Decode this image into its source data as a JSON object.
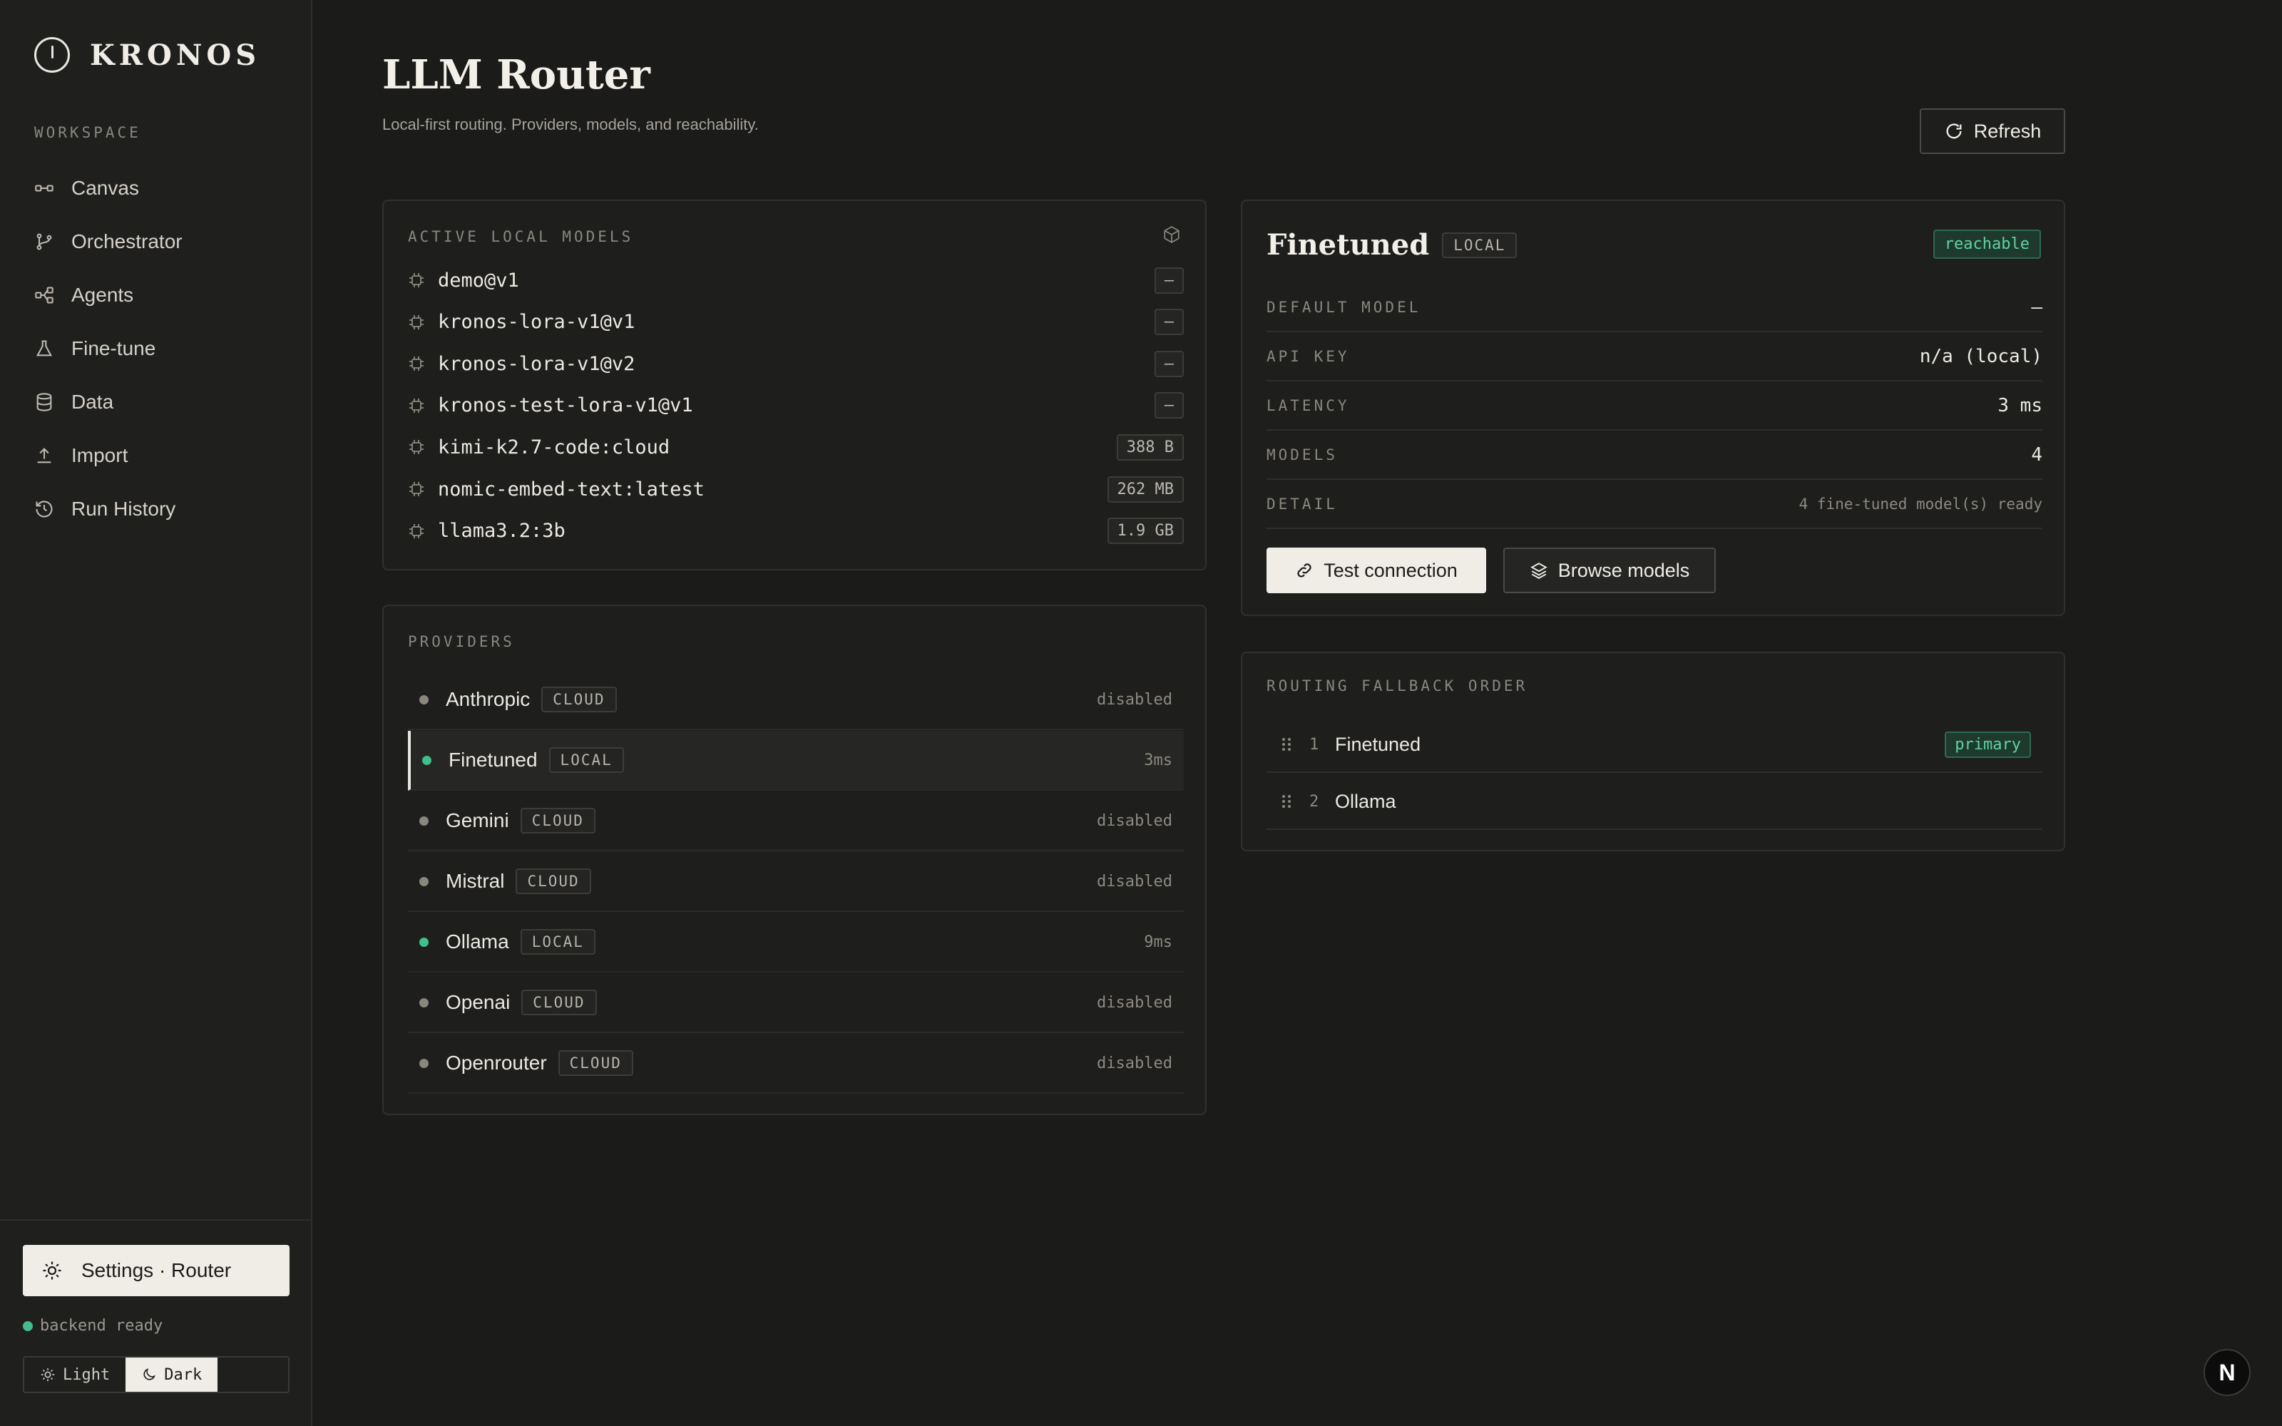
{
  "brand": {
    "name": "KRONOS"
  },
  "sidebar": {
    "section_label": "WORKSPACE",
    "items": [
      {
        "label": "Canvas",
        "icon": "canvas-icon"
      },
      {
        "label": "Orchestrator",
        "icon": "branch-icon"
      },
      {
        "label": "Agents",
        "icon": "share-icon"
      },
      {
        "label": "Fine-tune",
        "icon": "flask-icon"
      },
      {
        "label": "Data",
        "icon": "database-icon"
      },
      {
        "label": "Import",
        "icon": "upload-icon"
      },
      {
        "label": "Run History",
        "icon": "history-icon"
      }
    ],
    "settings_label": "Settings · Router",
    "status": "backend ready",
    "theme": {
      "light": "Light",
      "dark": "Dark",
      "selected": "Dark"
    }
  },
  "header": {
    "title": "LLM Router",
    "subtitle": "Local-first routing. Providers, models, and reachability.",
    "refresh_label": "Refresh"
  },
  "models": {
    "label": "ACTIVE LOCAL MODELS",
    "rows": [
      {
        "name": "demo@v1",
        "size": "—"
      },
      {
        "name": "kronos-lora-v1@v1",
        "size": "—"
      },
      {
        "name": "kronos-lora-v1@v2",
        "size": "—"
      },
      {
        "name": "kronos-test-lora-v1@v1",
        "size": "—"
      },
      {
        "name": "kimi-k2.7-code:cloud",
        "size": "388 B"
      },
      {
        "name": "nomic-embed-text:latest",
        "size": "262 MB"
      },
      {
        "name": "llama3.2:3b",
        "size": "1.9 GB"
      }
    ]
  },
  "providers": {
    "label": "PROVIDERS",
    "rows": [
      {
        "name": "Anthropic",
        "tag": "CLOUD",
        "meta": "disabled",
        "active": false
      },
      {
        "name": "Finetuned",
        "tag": "LOCAL",
        "meta": "3ms",
        "active": true
      },
      {
        "name": "Gemini",
        "tag": "CLOUD",
        "meta": "disabled",
        "active": false
      },
      {
        "name": "Mistral",
        "tag": "CLOUD",
        "meta": "disabled",
        "active": false
      },
      {
        "name": "Ollama",
        "tag": "LOCAL",
        "meta": "9ms",
        "active": true
      },
      {
        "name": "Openai",
        "tag": "CLOUD",
        "meta": "disabled",
        "active": false
      },
      {
        "name": "Openrouter",
        "tag": "CLOUD",
        "meta": "disabled",
        "active": false
      }
    ],
    "selected": "Finetuned"
  },
  "detail": {
    "name": "Finetuned",
    "tag": "LOCAL",
    "status": "reachable",
    "fields": [
      {
        "key": "DEFAULT MODEL",
        "value": "—"
      },
      {
        "key": "API KEY",
        "value": "n/a (local)"
      },
      {
        "key": "LATENCY",
        "value": "3 ms"
      },
      {
        "key": "MODELS",
        "value": "4"
      },
      {
        "key": "DETAIL",
        "value": "4 fine-tuned model(s) ready"
      }
    ],
    "test_label": "Test connection",
    "browse_label": "Browse models"
  },
  "routing": {
    "label": "ROUTING FALLBACK ORDER",
    "rows": [
      {
        "index": "1",
        "name": "Finetuned",
        "badge": "primary"
      },
      {
        "index": "2",
        "name": "Ollama",
        "badge": ""
      }
    ]
  },
  "corner_badge": "N",
  "colors": {
    "accent_green": "#3fbf8c",
    "background": "#1b1b1a",
    "text": "#e9e6df"
  }
}
